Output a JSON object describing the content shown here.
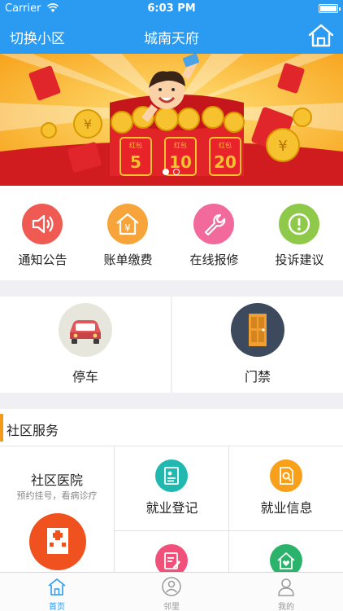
{
  "status_bar": {
    "carrier": "Carrier",
    "time": "6:03 PM"
  },
  "nav": {
    "switch_label": "切换小区",
    "title": "城南天府",
    "home_icon": "home-icon"
  },
  "banner": {
    "envelopes": [
      {
        "tag": "红包",
        "value": "5"
      },
      {
        "tag": "红包",
        "value": "10"
      },
      {
        "tag": "红包",
        "value": "20"
      }
    ],
    "coin_glyph": "¥",
    "page_count": 2,
    "active_page": 1
  },
  "quick_actions": [
    {
      "label": "通知公告",
      "icon": "speaker-icon",
      "color": "#ef5a52"
    },
    {
      "label": "账单缴费",
      "icon": "payment-house-icon",
      "color": "#f7a53b"
    },
    {
      "label": "在线报修",
      "icon": "wrench-icon",
      "color": "#f26a9b"
    },
    {
      "label": "投诉建议",
      "icon": "alert-icon",
      "color": "#8fc94a"
    }
  ],
  "features": [
    {
      "label": "停车",
      "icon": "car-icon",
      "color": "#e6e6dc"
    },
    {
      "label": "门禁",
      "icon": "door-icon",
      "color": "#3d4a5e"
    }
  ],
  "services": {
    "title": "社区服务",
    "hospital": {
      "name": "社区医院",
      "subtitle": "预约挂号，看病诊疗",
      "icon": "hospital-icon",
      "color": "#f0521f"
    },
    "items": [
      {
        "label": "就业登记",
        "icon": "id-card-icon",
        "color": "#21b8b0"
      },
      {
        "label": "就业信息",
        "icon": "document-search-icon",
        "color": "#f9a01b"
      },
      {
        "label": "",
        "icon": "form-edit-icon",
        "color": "#f0507a"
      },
      {
        "label": "",
        "icon": "house-heart-icon",
        "color": "#2cb36b"
      }
    ]
  },
  "tab_bar": {
    "tabs": [
      {
        "label": "首页",
        "icon": "home-tab-icon",
        "active": true
      },
      {
        "label": "邻里",
        "icon": "neighbors-icon",
        "active": false
      },
      {
        "label": "我的",
        "icon": "profile-icon",
        "active": false
      }
    ],
    "active_color": "#2a9bf0",
    "inactive_color": "#999999"
  }
}
